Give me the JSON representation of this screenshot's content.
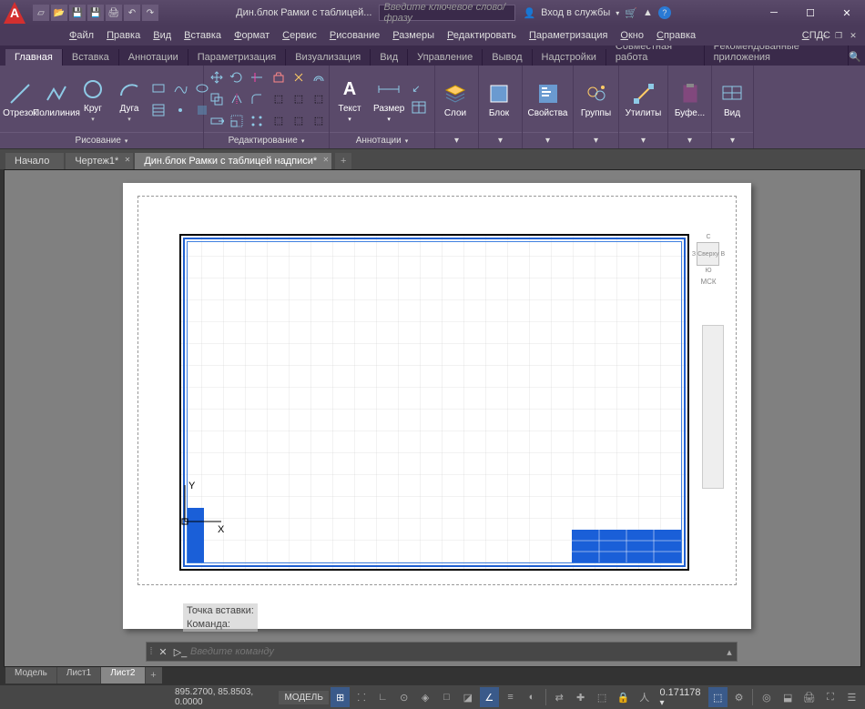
{
  "window": {
    "title": "Дин.блок Рамки с таблицей...",
    "search_ph": "Введите ключевое слово/фразу",
    "login": "Вход в службы"
  },
  "menu": [
    "Файл",
    "Правка",
    "Вид",
    "Вставка",
    "Формат",
    "Сервис",
    "Рисование",
    "Размеры",
    "Редактировать",
    "Параметризация",
    "Окно",
    "Справка",
    "СПДС"
  ],
  "ribbontabs": [
    "Главная",
    "Вставка",
    "Аннотации",
    "Параметризация",
    "Визуализация",
    "Вид",
    "Управление",
    "Вывод",
    "Надстройки",
    "Совместная работа",
    "Рекомендованные приложения"
  ],
  "panels": {
    "draw": {
      "title": "Рисование",
      "btns": {
        "line": "Отрезок",
        "pline": "Полилиния",
        "circle": "Круг",
        "arc": "Дуга"
      }
    },
    "modify": {
      "title": "Редактирование"
    },
    "annot": {
      "title": "Аннотации",
      "btns": {
        "text": "Текст",
        "dim": "Размер"
      }
    },
    "layers": {
      "title": "Слои"
    },
    "block": {
      "title": "Блок"
    },
    "props": {
      "title": "Свойства"
    },
    "groups": {
      "title": "Группы"
    },
    "utils": {
      "title": "Утилиты"
    },
    "clip": {
      "title": "Буфе..."
    },
    "view": {
      "title": "Вид"
    }
  },
  "filetabs": [
    {
      "label": "Начало",
      "active": false
    },
    {
      "label": "Чертеж1*",
      "active": false
    },
    {
      "label": "Дин.блок Рамки с таблицей надписи*",
      "active": true
    }
  ],
  "viewcube": {
    "top": "Сверху",
    "wcs": "МСК",
    "n": "С",
    "e": "В",
    "s": "Ю",
    "w": "З"
  },
  "cmd": {
    "hist1": "Точка вставки:",
    "hist2": "Команда:",
    "placeholder": "Введите команду"
  },
  "layouts": [
    {
      "label": "Модель"
    },
    {
      "label": "Лист1"
    },
    {
      "label": "Лист2",
      "active": true
    }
  ],
  "status": {
    "coords": "895.2700, 85.8503, 0.0000",
    "model": "МОДЕЛЬ",
    "scale": "0.171178"
  }
}
